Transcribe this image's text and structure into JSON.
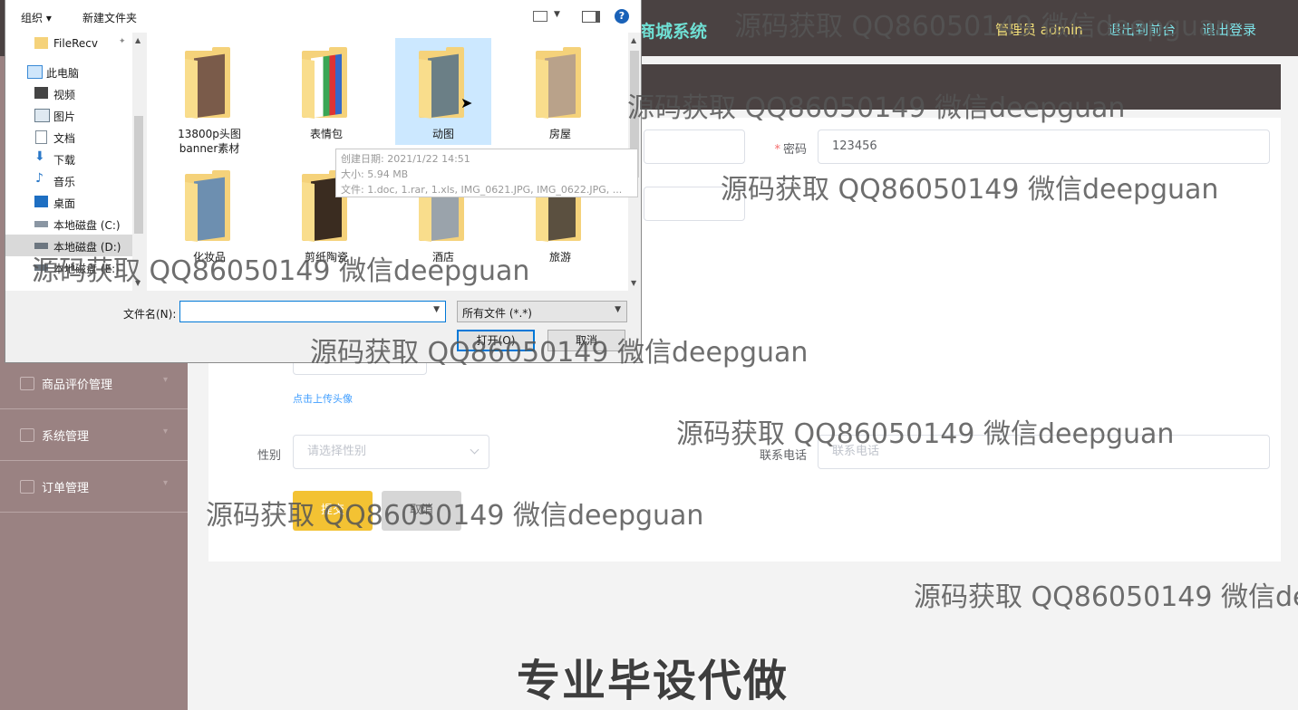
{
  "app": {
    "title": "商城系统",
    "user_label": "管理员 admin",
    "back_link": "退出到前台",
    "logout_link": "退出登录"
  },
  "sidebar": {
    "items": [
      {
        "label": "商品评价管理",
        "icon": "house-icon"
      },
      {
        "label": "系统管理",
        "icon": "box-icon"
      },
      {
        "label": "订单管理",
        "icon": "list-icon"
      }
    ]
  },
  "form": {
    "password_label": "密码",
    "password_value": "123456",
    "upload_hint": "点击上传头像",
    "gender_label": "性别",
    "gender_placeholder": "请选择性别",
    "phone_label": "联系电话",
    "phone_placeholder": "联系电话",
    "submit_label": "提交",
    "cancel_label": "取消"
  },
  "dialog": {
    "toolbar": {
      "organize": "组织 ▾",
      "new_folder": "新建文件夹"
    },
    "nav": [
      {
        "label": "FileRecv",
        "icon": "folder-icon"
      },
      {
        "label": "此电脑",
        "icon": "computer-icon"
      },
      {
        "label": "视频",
        "icon": "video-icon"
      },
      {
        "label": "图片",
        "icon": "picture-icon"
      },
      {
        "label": "文档",
        "icon": "document-icon"
      },
      {
        "label": "下载",
        "icon": "download-icon"
      },
      {
        "label": "音乐",
        "icon": "music-icon"
      },
      {
        "label": "桌面",
        "icon": "desktop-icon"
      },
      {
        "label": "本地磁盘 (C:)",
        "icon": "drive-icon"
      },
      {
        "label": "本地磁盘 (D:)",
        "icon": "drive-icon"
      },
      {
        "label": "本地磁盘 (E:)",
        "icon": "drive-icon"
      }
    ],
    "folders": [
      {
        "label": "13800p头图banner素材",
        "color": "#7a5b4a"
      },
      {
        "label": "表情包",
        "color": "#3aa655"
      },
      {
        "label": "动图",
        "color": "#6b7f86"
      },
      {
        "label": "房屋",
        "color": "#b9a28a"
      },
      {
        "label": "化妆品",
        "color": "#6d8fb0"
      },
      {
        "label": "剪纸陶瓷",
        "color": "#3a2c20"
      },
      {
        "label": "酒店",
        "color": "#9aa3ab"
      },
      {
        "label": "旅游",
        "color": "#5b5040"
      }
    ],
    "tooltip": {
      "created": "创建日期: 2021/1/22 14:51",
      "size": "大小: 5.94 MB",
      "files": "文件: 1.doc, 1.rar, 1.xls, IMG_0621.JPG, IMG_0622.JPG, ..."
    },
    "filename_label": "文件名(N):",
    "filename_value": "",
    "filetype": "所有文件 (*.*)",
    "open_label": "打开(O)",
    "cancel_label": "取消"
  },
  "watermarks": [
    "源码获取 QQ86050149 微信deepguan",
    "源码获取 QQ86050149 微信deepguan",
    "源码获取 QQ86050149 微信deepguan",
    "源码获取 QQ86050149 微信deepguan",
    "源码获取 QQ86050149 微信deepguan",
    "源码获取 QQ86050149 微信deepguan",
    "源码获取 QQ86050149 微信deepguan",
    "源码获取 QQ86050149 微信de"
  ],
  "promo": "专业毕设代做"
}
